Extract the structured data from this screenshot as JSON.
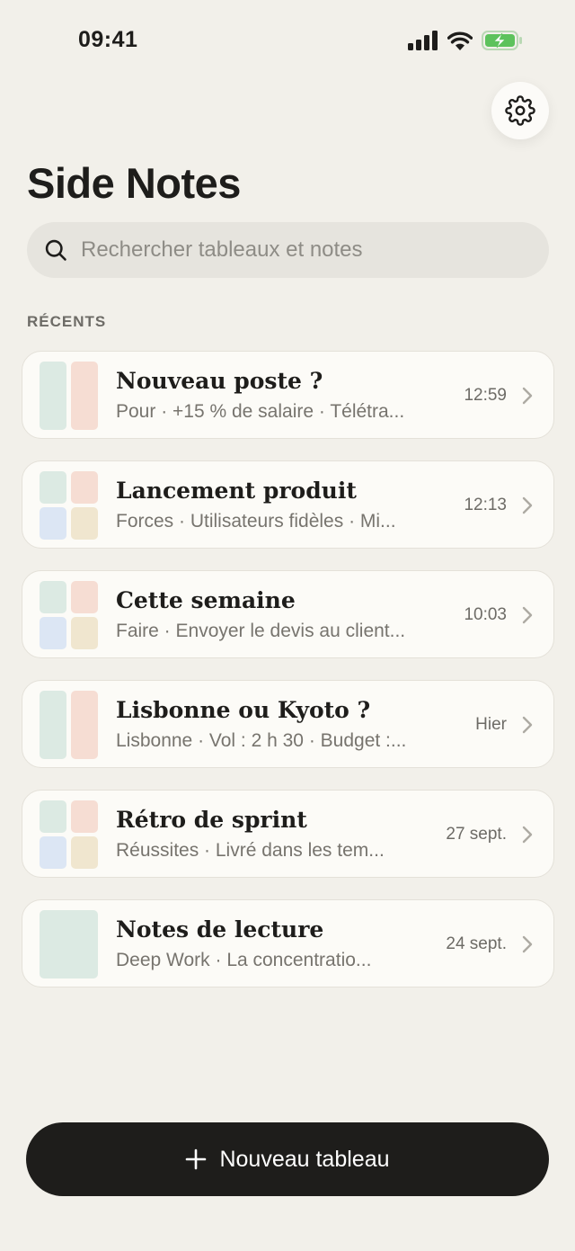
{
  "status_bar": {
    "time": "09:41"
  },
  "header": {
    "title": "Side Notes",
    "settings_icon": "gear-icon"
  },
  "search": {
    "placeholder": "Rechercher tableaux et notes",
    "value": ""
  },
  "section": {
    "label": "RÉCENTS"
  },
  "boards": [
    {
      "title": "Nouveau poste ?",
      "subtitle": "Pour · +15 % de salaire · Télétra...",
      "time": "12:59",
      "layout": "two-columns"
    },
    {
      "title": "Lancement produit",
      "subtitle": "Forces · Utilisateurs fidèles · Mi...",
      "time": "12:13",
      "layout": "grid-2x2"
    },
    {
      "title": "Cette semaine",
      "subtitle": "Faire · Envoyer le devis au client...",
      "time": "10:03",
      "layout": "grid-2x2"
    },
    {
      "title": "Lisbonne ou Kyoto ?",
      "subtitle": "Lisbonne · Vol : 2 h 30 · Budget :...",
      "time": "Hier",
      "layout": "two-columns"
    },
    {
      "title": "Rétro de sprint",
      "subtitle": "Réussites · Livré dans les tem...",
      "time": "27 sept.",
      "layout": "grid-2x2"
    },
    {
      "title": "Notes de lecture",
      "subtitle": "Deep Work · La concentratio...",
      "time": "24 sept.",
      "layout": "single"
    }
  ],
  "colors": {
    "green": "#DCEAE3",
    "pink": "#F6DDD3",
    "blue": "#DCE6F4",
    "yellow": "#F0E6CF",
    "background": "#F2F0EA",
    "button": "#1E1D1B"
  },
  "footer": {
    "new_board_label": "Nouveau tableau"
  }
}
